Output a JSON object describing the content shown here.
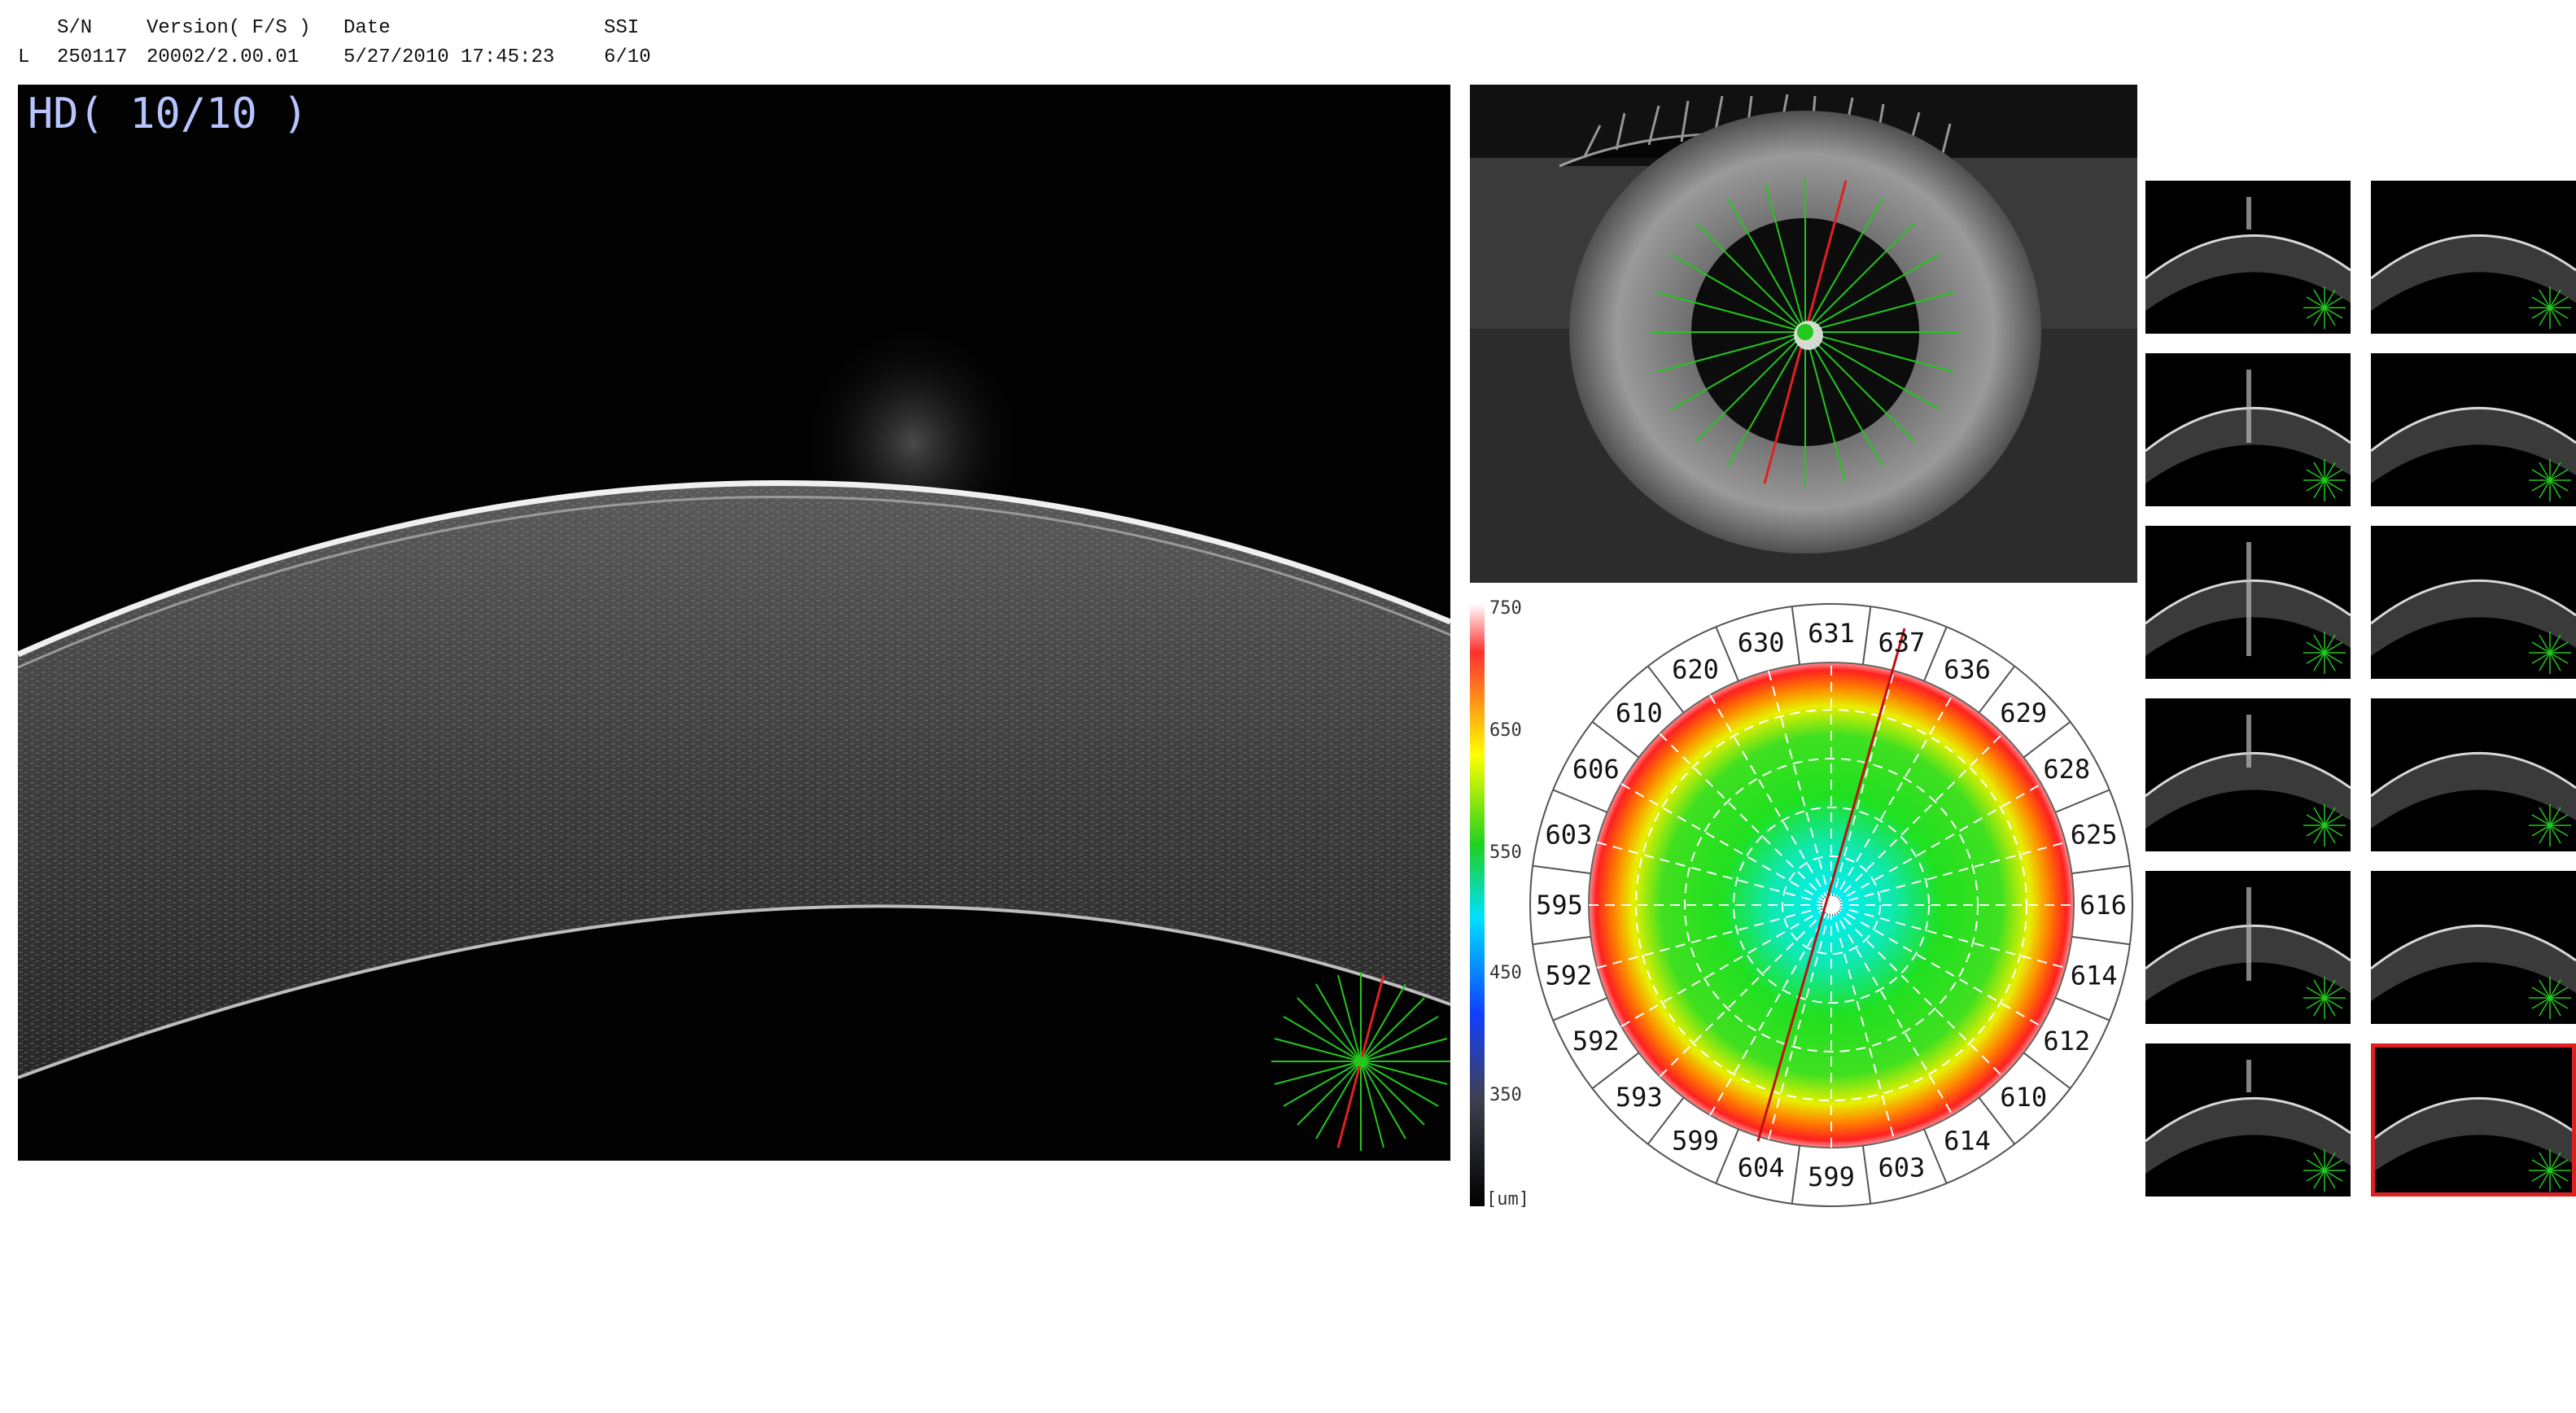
{
  "header": {
    "eye": "L",
    "sn_label": "S/N",
    "sn_value": "250117",
    "version_label": "Version( F/S )",
    "version_value": "20002/2.00.01",
    "date_label": "Date",
    "date_value": "5/27/2010 17:45:23",
    "ssi_label": "SSI",
    "ssi_value": "6/10"
  },
  "main_scan": {
    "label": "HD( 10/10 )",
    "label_color": "#b8c4ff"
  },
  "colorbar": {
    "ticks": [
      "750",
      "650",
      "550",
      "450",
      "350"
    ],
    "unit": "[um]"
  },
  "pachymetry": {
    "outer_ring_labels": [
      "637",
      "636",
      "629",
      "628",
      "625",
      "616",
      "614",
      "612",
      "610",
      "614",
      "603",
      "599",
      "604",
      "599",
      "593",
      "592",
      "592",
      "595",
      "603",
      "606",
      "610",
      "620",
      "630",
      "631"
    ]
  },
  "thumbnails": {
    "count": 12,
    "selected_index": 11
  },
  "colors": {
    "scan_line": "#22c81e",
    "selected_scan": "#e02020",
    "thin": "#00e0ff",
    "normal": "#20d020",
    "thick": "#ff2020"
  }
}
